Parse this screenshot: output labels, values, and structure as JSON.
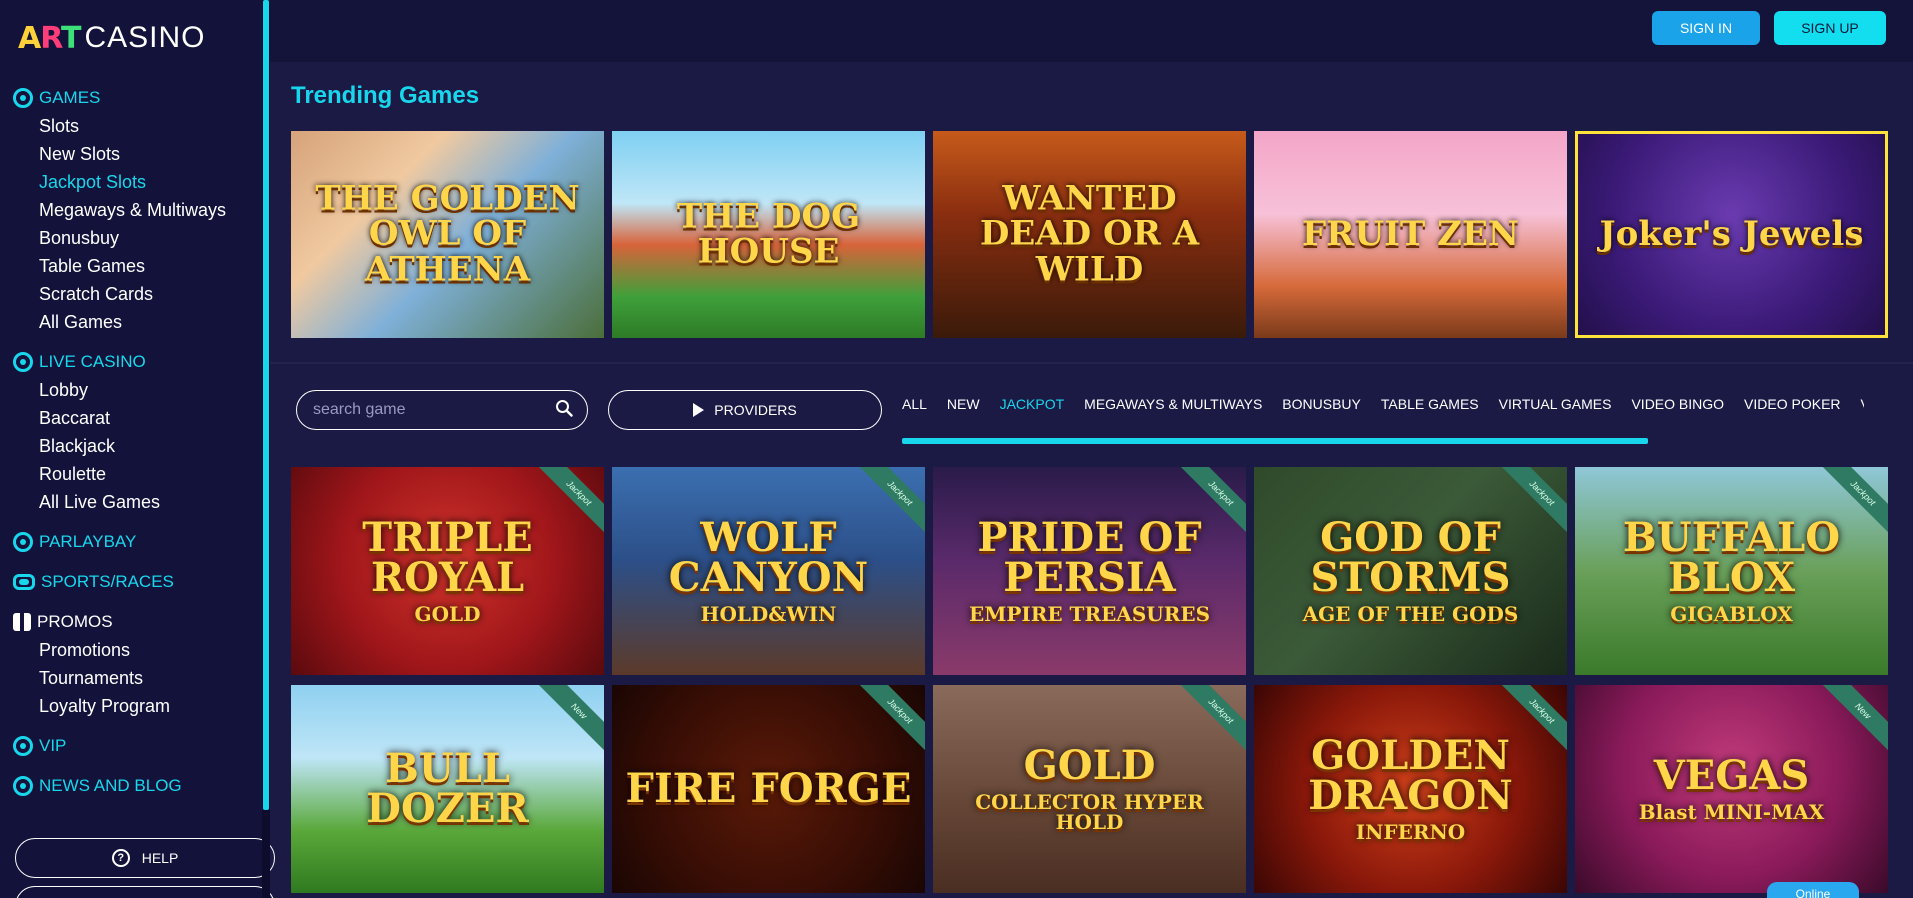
{
  "brand": {
    "art": "ART",
    "word": "CASINO"
  },
  "colors": {
    "accent": "#18d7ec",
    "bg": "#1b1a45",
    "sidebar": "#13123a",
    "signin": "#1aa3e8",
    "signup": "#12def0"
  },
  "header": {
    "sign_in": "SIGN IN",
    "sign_up": "SIGN UP"
  },
  "sidebar": {
    "games": {
      "label": "GAMES",
      "icon": "games-icon",
      "items": [
        "Slots",
        "New Slots",
        "Jackpot Slots",
        "Megaways & Multiways",
        "Bonusbuy",
        "Table Games",
        "Scratch Cards",
        "All Games"
      ],
      "active": "Jackpot Slots"
    },
    "live": {
      "label": "LIVE CASINO",
      "icon": "live-casino-icon",
      "items": [
        "Lobby",
        "Baccarat",
        "Blackjack",
        "Roulette",
        "All Live Games"
      ]
    },
    "parlaybay": {
      "label": "PARLAYBAY",
      "icon": "parlaybay-icon"
    },
    "sports": {
      "label": "SPORTS/RACES",
      "icon": "sports-icon"
    },
    "promos": {
      "label": "PROMOS",
      "icon": "gift-icon",
      "items": [
        "Promotions",
        "Tournaments",
        "Loyalty Program"
      ]
    },
    "vip": {
      "label": "VIP",
      "icon": "vip-icon"
    },
    "news": {
      "label": "NEWS AND BLOG",
      "icon": "news-icon"
    },
    "help": "HELP"
  },
  "trending": {
    "title": "Trending Games",
    "games": [
      {
        "name": "THE GOLDEN OWL OF ATHENA",
        "bg": "linear-gradient(135deg,#d6a37a 0%,#f0c9a0 30%,#7fb0d8 55%,#4b6e3a 100%)"
      },
      {
        "name": "THE DOG HOUSE",
        "bg": "linear-gradient(180deg,#7fd0f2 0%,#bfe6f7 35%,#d8633a 55%,#3fa03a 80%,#2d7b26 100%)"
      },
      {
        "name": "WANTED DEAD OR A WILD",
        "bg": "linear-gradient(180deg,#c65a1a 0%,#8a2e10 40%,#3a1a0a 100%)"
      },
      {
        "name": "FRUIT ZEN",
        "bg": "linear-gradient(180deg,#f4a6c8 0%,#f7c1d8 40%,#d66a3a 75%,#7a3a1a 100%)"
      },
      {
        "name": "Joker's Jewels",
        "bg": "radial-gradient(circle at 50% 40%,#6a3bb0 0%,#3b1a78 60%,#22104a 100%)"
      }
    ]
  },
  "search": {
    "placeholder": "search game"
  },
  "providers_label": "PROVIDERS",
  "filters": [
    {
      "label": "ALL"
    },
    {
      "label": "NEW"
    },
    {
      "label": "JACKPOT"
    },
    {
      "label": "MEGAWAYS & MULTIWAYS"
    },
    {
      "label": "BONUSBUY"
    },
    {
      "label": "TABLE GAMES"
    },
    {
      "label": "VIRTUAL GAMES"
    },
    {
      "label": "VIDEO BINGO"
    },
    {
      "label": "VIDEO POKER"
    },
    {
      "label": "VID"
    }
  ],
  "active_filter": "JACKPOT",
  "games": [
    {
      "name": "TRIPLE ROYAL",
      "sub": "GOLD",
      "ribbon": "Jackpot",
      "bg": "radial-gradient(circle at 50% 45%,#d0342c 0%,#a0161a 55%,#5a0a0e 100%)"
    },
    {
      "name": "WOLF CANYON",
      "sub": "HOLD&WIN",
      "ribbon": "Jackpot",
      "bg": "linear-gradient(180deg,#3b6fb0 0%,#2c4f88 45%,#5c3a2a 100%)"
    },
    {
      "name": "PRIDE OF PERSIA",
      "sub": "EMPIRE TREASURES",
      "ribbon": "Jackpot",
      "bg": "linear-gradient(180deg,#2a1b4a 0%,#5a2a6a 45%,#8a3a6a 100%)"
    },
    {
      "name": "GOD OF STORMS",
      "sub": "AGE OF THE GODS",
      "ribbon": "Jackpot",
      "bg": "linear-gradient(135deg,#2f4a2a 0%,#3b5a38 45%,#1a2a1a 100%)"
    },
    {
      "name": "BUFFALO BLOX",
      "sub": "GIGABLOX",
      "ribbon": "Jackpot",
      "bg": "linear-gradient(180deg,#8fc7d8 0%,#6aa05a 50%,#3b7a2a 100%)"
    },
    {
      "name": "BULL DOZER",
      "sub": "",
      "ribbon": "New",
      "bg": "linear-gradient(180deg,#8fd0f0 0%,#bfe6f7 35%,#5aa83a 70%,#2f7a1f 100%)"
    },
    {
      "name": "FIRE FORGE",
      "sub": "",
      "ribbon": "Jackpot",
      "bg": "radial-gradient(circle at 50% 50%,#5a1a08 0%,#3a0e05 55%,#1a0603 100%)"
    },
    {
      "name": "GOLD",
      "sub": "COLLECTOR HYPER HOLD",
      "ribbon": "Jackpot",
      "bg": "linear-gradient(180deg,#8a6a5a 0%,#6a4a3a 50%,#4a2e22 100%)"
    },
    {
      "name": "GOLDEN DRAGON",
      "sub": "INFERNO",
      "ribbon": "Jackpot",
      "bg": "radial-gradient(circle at 50% 50%,#d0401a 0%,#8a180a 55%,#3a0604 100%)"
    },
    {
      "name": "VEGAS",
      "sub": "Blast MINI-MAX",
      "ribbon": "New",
      "bg": "radial-gradient(circle at 50% 40%,#c03a7a 0%,#8a1a5a 55%,#3a0a2a 100%)"
    }
  ],
  "online_badge": "Online"
}
